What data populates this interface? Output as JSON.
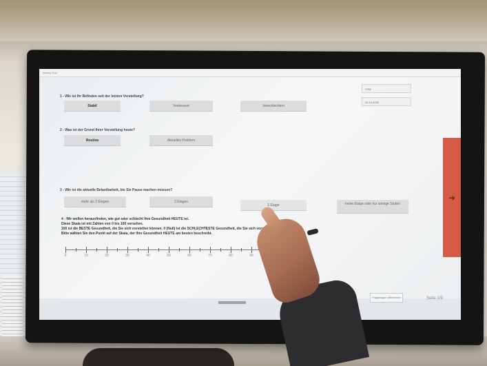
{
  "window": {
    "title": "Survey Tool"
  },
  "header": {
    "field_id": "1762",
    "field_date": "23.10.2020"
  },
  "q1": {
    "text": "1 - Wie ist Ihr Befinden seit der letzten Vorstellung?",
    "options": [
      "Stabil",
      "Verbessert",
      "Verschlechtert"
    ]
  },
  "q2": {
    "text": "2 - Was ist der Grund Ihrer Vorstellung heute?",
    "options": [
      "Routine",
      "Aktuelles Problem"
    ]
  },
  "q3": {
    "text": "3 - Wie ist die aktuelle Belastbarkeit, bis Sie Pause machen müssen?",
    "options": [
      "mehr als 2 Etagen",
      "2 Etagen",
      "1 Etage",
      "keine Etage oder nur wenige Stufen"
    ]
  },
  "q4": {
    "line1": "4 - Wir wollen herausfinden, wie gut oder schlecht Ihre Gesundheit HEUTE ist.",
    "line2": "Diese Skala ist mit Zahlen von 0 bis 100 versehen.",
    "line3": "100 ist die BESTE Gesundheit, die Sie sich vorstellen können. 0 (Null) ist die SCHLECHTESTE Gesundheit, die Sie sich vorstellen können.",
    "line4": "Bitte wählen Sie den Punkt auf der Skala, der Ihre Gesundheit HEUTE am besten beschreibt.",
    "scale_labels": [
      "0",
      "10",
      "20",
      "30",
      "40",
      "50",
      "60",
      "70",
      "80",
      "90"
    ]
  },
  "footer": {
    "cancel_label": "Fragebogen abbrechen",
    "page_label": "Seite 1/9"
  },
  "next": {
    "icon": "arrow-right-icon",
    "glyph": "➔"
  },
  "colors": {
    "next_bar": "#d65a45",
    "option_bg": "#dadcde"
  }
}
